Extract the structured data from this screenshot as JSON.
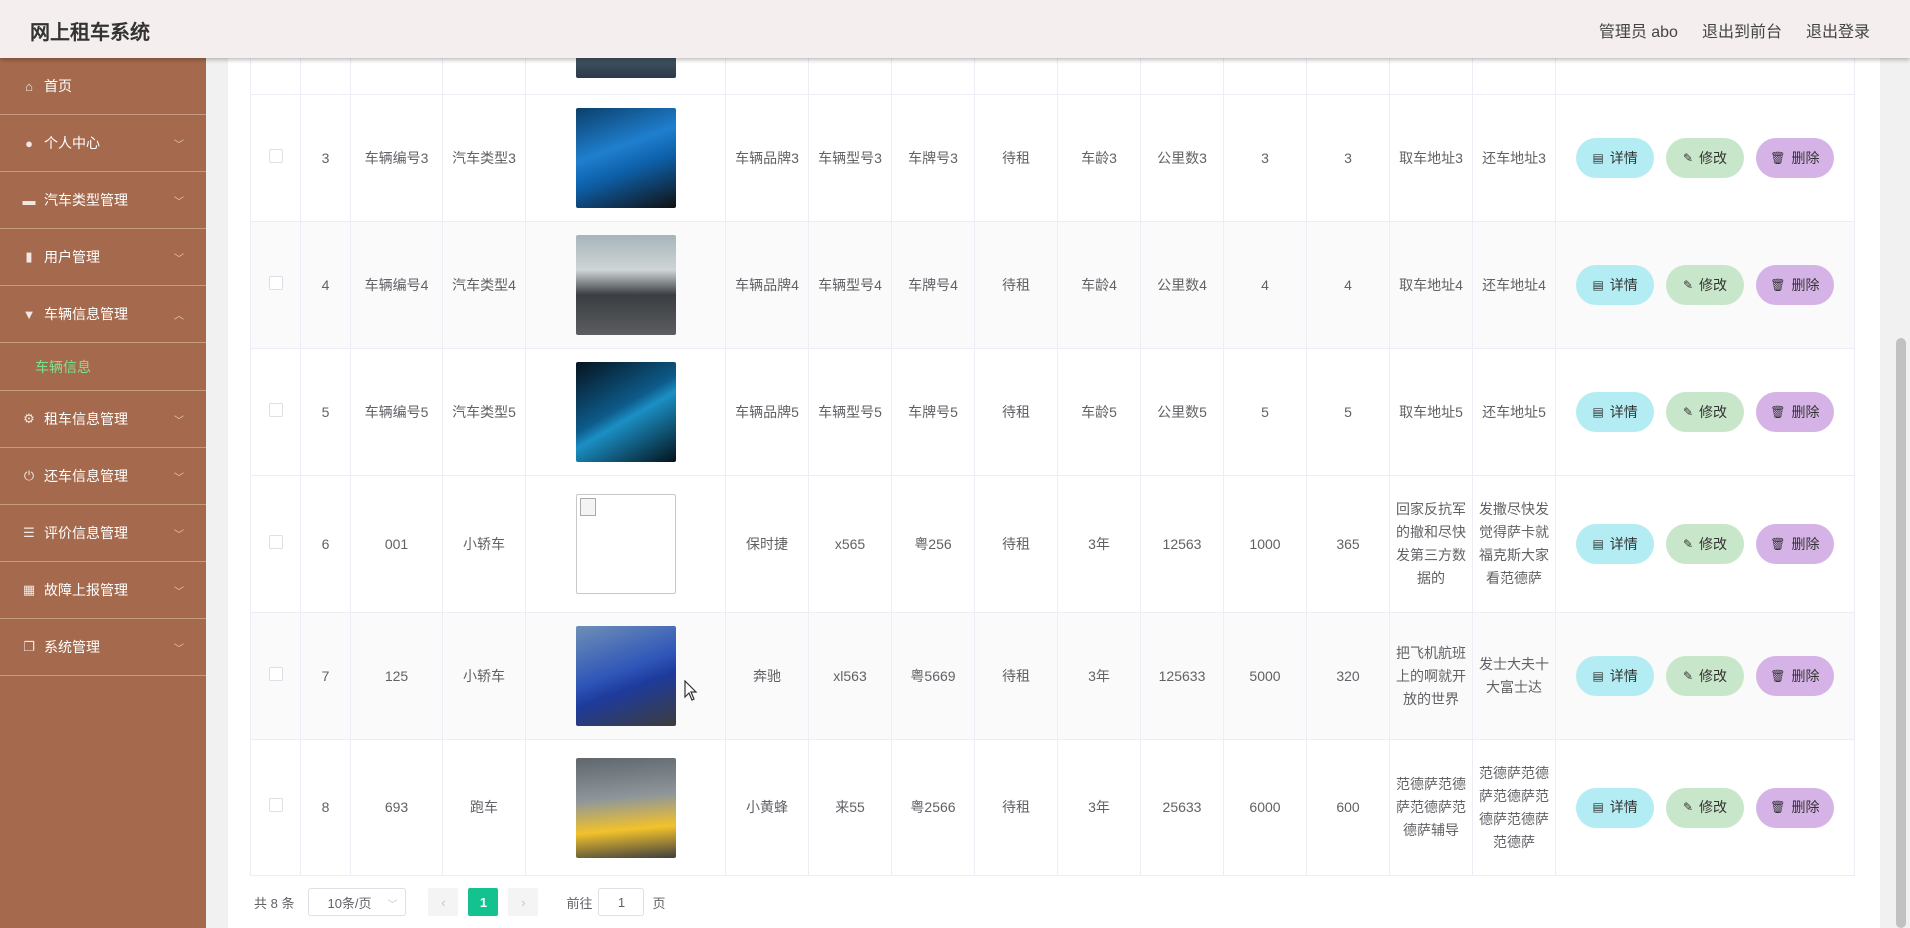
{
  "header": {
    "title": "网上租车系统",
    "admin": "管理员 abo",
    "to_front": "退出到前台",
    "logout": "退出登录"
  },
  "sidebar": {
    "items": [
      {
        "label": "首页",
        "icon": "home-icon"
      },
      {
        "label": "个人中心",
        "icon": "user-icon"
      },
      {
        "label": "汽车类型管理",
        "icon": "briefcase-icon"
      },
      {
        "label": "用户管理",
        "icon": "chart-icon"
      },
      {
        "label": "车辆信息管理",
        "icon": "pin-icon"
      },
      {
        "label": "车辆信息",
        "icon": ""
      },
      {
        "label": "租车信息管理",
        "icon": "settings-icon"
      },
      {
        "label": "还车信息管理",
        "icon": "power-icon"
      },
      {
        "label": "评价信息管理",
        "icon": "list-icon"
      },
      {
        "label": "故障上报管理",
        "icon": "grid-icon"
      },
      {
        "label": "系统管理",
        "icon": "copy-icon"
      }
    ]
  },
  "table": {
    "rows": [
      {
        "index": "3",
        "code": "车辆编号3",
        "type": "汽车类型3",
        "brand": "车辆品牌3",
        "model": "车辆型号3",
        "plate": "车牌号3",
        "status": "待租",
        "age": "车龄3",
        "mileage": "公里数3",
        "c1": "3",
        "c2": "3",
        "pickup": "取车地址3",
        "return": "还车地址3"
      },
      {
        "index": "4",
        "code": "车辆编号4",
        "type": "汽车类型4",
        "brand": "车辆品牌4",
        "model": "车辆型号4",
        "plate": "车牌号4",
        "status": "待租",
        "age": "车龄4",
        "mileage": "公里数4",
        "c1": "4",
        "c2": "4",
        "pickup": "取车地址4",
        "return": "还车地址4"
      },
      {
        "index": "5",
        "code": "车辆编号5",
        "type": "汽车类型5",
        "brand": "车辆品牌5",
        "model": "车辆型号5",
        "plate": "车牌号5",
        "status": "待租",
        "age": "车龄5",
        "mileage": "公里数5",
        "c1": "5",
        "c2": "5",
        "pickup": "取车地址5",
        "return": "还车地址5"
      },
      {
        "index": "6",
        "code": "001",
        "type": "小轿车",
        "brand": "保时捷",
        "model": "x565",
        "plate": "粤256",
        "status": "待租",
        "age": "3年",
        "mileage": "12563",
        "c1": "1000",
        "c2": "365",
        "pickup": "回家反抗军的撤和尽快发第三方数据的",
        "return": "发撒尽快发觉得萨卡就福克斯大家看范德萨"
      },
      {
        "index": "7",
        "code": "125",
        "type": "小轿车",
        "brand": "奔驰",
        "model": "xl563",
        "plate": "粤5669",
        "status": "待租",
        "age": "3年",
        "mileage": "125633",
        "c1": "5000",
        "c2": "320",
        "pickup": "把飞机航班上的啊就开放的世界",
        "return": "发士大夫十大富士达"
      },
      {
        "index": "8",
        "code": "693",
        "type": "跑车",
        "brand": "小黄蜂",
        "model": "来55",
        "plate": "粤2566",
        "status": "待租",
        "age": "3年",
        "mileage": "25633",
        "c1": "6000",
        "c2": "600",
        "pickup": "范德萨范德萨范德萨范德萨辅导",
        "return": "范德萨范德萨范德萨范德萨范德萨范德萨"
      }
    ],
    "buttons": {
      "detail": "详情",
      "edit": "修改",
      "delete": "删除"
    }
  },
  "pagination": {
    "total": "共 8 条",
    "page_size": "10条/页",
    "current": "1",
    "goto_prefix": "前往",
    "goto_value": "1",
    "goto_suffix": "页"
  },
  "colors": {
    "sidebar": "#a56a4d",
    "active_sub": "#7fe08f",
    "page_active": "#13c28f"
  }
}
